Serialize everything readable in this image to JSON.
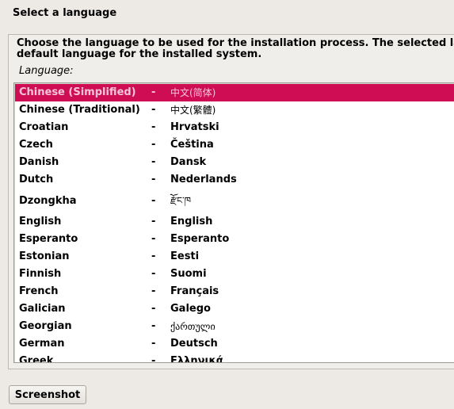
{
  "header": {
    "title": "Select a language"
  },
  "panel": {
    "description_line1": "Choose the language to be used for the installation process. The selected language will also be the",
    "description_line2": "default language for the installed system.",
    "field_label": "Language:"
  },
  "languages": {
    "selected_index": 0,
    "items": [
      {
        "name": "Chinese (Simplified)",
        "sep": "-",
        "native": "中文(简体)",
        "cjk": true
      },
      {
        "name": "Chinese (Traditional)",
        "sep": "-",
        "native": "中文(繁體)",
        "cjk": true
      },
      {
        "name": "Croatian",
        "sep": "-",
        "native": "Hrvatski"
      },
      {
        "name": "Czech",
        "sep": "-",
        "native": "Čeština"
      },
      {
        "name": "Danish",
        "sep": "-",
        "native": "Dansk"
      },
      {
        "name": "Dutch",
        "sep": "-",
        "native": "Nederlands"
      },
      {
        "name": "Dzongkha",
        "sep": "-",
        "native": "རྫོང་ཁ",
        "cjk": true,
        "tall": true
      },
      {
        "name": "English",
        "sep": "-",
        "native": "English"
      },
      {
        "name": "Esperanto",
        "sep": "-",
        "native": "Esperanto"
      },
      {
        "name": "Estonian",
        "sep": "-",
        "native": "Eesti"
      },
      {
        "name": "Finnish",
        "sep": "-",
        "native": "Suomi"
      },
      {
        "name": "French",
        "sep": "-",
        "native": "Français"
      },
      {
        "name": "Galician",
        "sep": "-",
        "native": "Galego"
      },
      {
        "name": "Georgian",
        "sep": "-",
        "native": "ქართული",
        "cjk": true
      },
      {
        "name": "German",
        "sep": "-",
        "native": "Deutsch"
      },
      {
        "name": "Greek",
        "sep": "-",
        "native": "Ελληνικά"
      }
    ]
  },
  "footer": {
    "screenshot_label": "Screenshot"
  },
  "colors": {
    "selection": "#ce0d55",
    "selection_text": "#f6c6d8"
  }
}
